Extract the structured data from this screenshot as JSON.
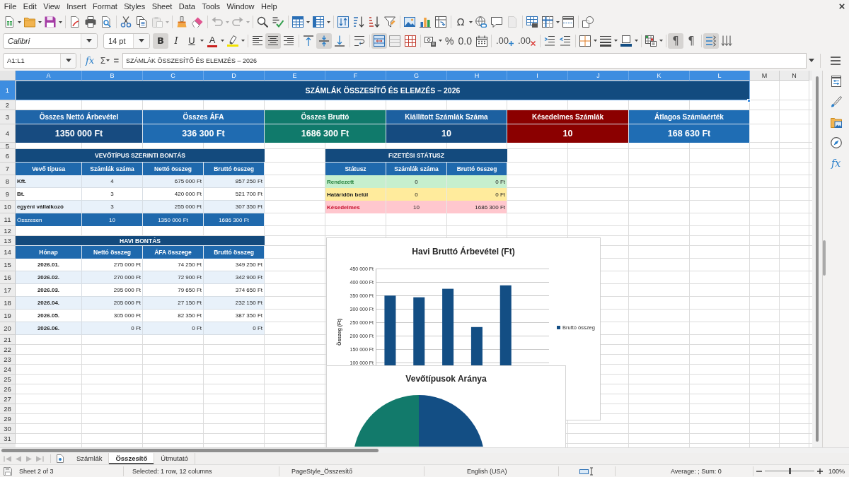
{
  "menu": [
    "File",
    "Edit",
    "View",
    "Insert",
    "Format",
    "Styles",
    "Sheet",
    "Data",
    "Tools",
    "Window",
    "Help"
  ],
  "standard_toolbar": {
    "paste": {
      "disabled": true
    },
    "undo": {
      "disabled": true
    },
    "redo": {
      "disabled": true
    },
    "special_character": "Ω",
    "headers_footers": {
      "disabled": true
    }
  },
  "format_toolbar": {
    "font_name": "Calibri",
    "font_size": "14 pt",
    "text_style": [
      {
        "label": "B",
        "selected": true
      },
      {
        "label": "I",
        "selected": false
      },
      {
        "label": "U",
        "selected": false
      }
    ],
    "font_color": "A",
    "horizontal_align": [
      {
        "selected": false
      },
      {
        "selected": true
      },
      {
        "selected": false
      }
    ],
    "vertical_align": [
      {
        "selected": false
      },
      {
        "selected": true
      },
      {
        "selected": false
      }
    ],
    "wrap_text": [
      {
        "selected": false
      }
    ],
    "merge": [
      {
        "selected": true
      },
      {
        "selected": false
      },
      {
        "selected": false
      }
    ],
    "number_format": [
      "%",
      "0.0"
    ],
    "decimals": [
      ".00",
      ".00"
    ],
    "paragraph_direction": [
      {
        "label": "¶",
        "selected": true
      },
      {
        "label": "¶",
        "selected": false
      }
    ],
    "text_direction": [
      {
        "selected": true
      },
      {
        "selected": false
      }
    ]
  },
  "formula_bar": {
    "name_box": "A1:L1",
    "function_wizard": "fx",
    "sum": "Σ",
    "equals": "=",
    "content": "SZÁMLÁK ÖSSZESÍTŐ ÉS ELEMZÉS – 2026"
  },
  "sheet": {
    "columns": [
      {
        "label": "A",
        "selected": true
      },
      {
        "label": "B",
        "selected": true
      },
      {
        "label": "C",
        "selected": true
      },
      {
        "label": "D",
        "selected": true
      },
      {
        "label": "E",
        "selected": true
      },
      {
        "label": "F",
        "selected": true
      },
      {
        "label": "G",
        "selected": true
      },
      {
        "label": "H",
        "selected": true
      },
      {
        "label": "I",
        "selected": true
      },
      {
        "label": "J",
        "selected": true
      },
      {
        "label": "K",
        "selected": true
      },
      {
        "label": "L",
        "selected": true
      },
      {
        "label": "M",
        "selected": false
      },
      {
        "label": "N",
        "selected": false
      }
    ],
    "rows": [
      {
        "label": "1",
        "selected": true
      },
      {
        "label": "2",
        "selected": false
      },
      {
        "label": "3",
        "selected": false
      },
      {
        "label": "4",
        "selected": false
      },
      {
        "label": "5",
        "selected": false
      },
      {
        "label": "6",
        "selected": false
      },
      {
        "label": "7",
        "selected": false
      },
      {
        "label": "8",
        "selected": false
      },
      {
        "label": "9",
        "selected": false
      },
      {
        "label": "10",
        "selected": false
      },
      {
        "label": "11",
        "selected": false
      },
      {
        "label": "12",
        "selected": false
      },
      {
        "label": "13",
        "selected": false
      },
      {
        "label": "14",
        "selected": false
      },
      {
        "label": "15",
        "selected": false
      },
      {
        "label": "16",
        "selected": false
      },
      {
        "label": "17",
        "selected": false
      },
      {
        "label": "18",
        "selected": false
      },
      {
        "label": "19",
        "selected": false
      },
      {
        "label": "20",
        "selected": false
      },
      {
        "label": "21",
        "selected": false
      },
      {
        "label": "22",
        "selected": false
      },
      {
        "label": "23",
        "selected": false
      },
      {
        "label": "24",
        "selected": false
      },
      {
        "label": "25",
        "selected": false
      },
      {
        "label": "26",
        "selected": false
      },
      {
        "label": "27",
        "selected": false
      },
      {
        "label": "28",
        "selected": false
      },
      {
        "label": "29",
        "selected": false
      },
      {
        "label": "30",
        "selected": false
      },
      {
        "label": "31",
        "selected": false
      }
    ],
    "title": "SZÁMLÁK ÖSSZESÍTŐ ÉS ELEMZÉS – 2026",
    "kpis": [
      {
        "label": {
          "text": "Összes Nettó Árbevétel",
          "color": "#1f65a8"
        },
        "value": {
          "text": "1350 000 Ft",
          "color": "#174b80"
        }
      },
      {
        "label": {
          "text": "Összes ÁFA",
          "color": "#1f6bb1"
        },
        "value": {
          "text": "336 300 Ft",
          "color": "#1f6bb1"
        }
      },
      {
        "label": {
          "text": "Összes Bruttó",
          "color": "#107a6b"
        },
        "value": {
          "text": "1686 300 Ft",
          "color": "#107a6b"
        }
      },
      {
        "label": {
          "text": "Kiállított Számlák Száma",
          "color": "#1c60a0"
        },
        "value": {
          "text": "10",
          "color": "#154b80"
        }
      },
      {
        "label": {
          "text": "Késedelmes Számlák",
          "color": "#8b0000"
        },
        "value": {
          "text": "10",
          "color": "#8b0000"
        }
      },
      {
        "label": {
          "text": "Átlagos Számlaérték",
          "color": "#1f6db4"
        },
        "value": {
          "text": "168 630 Ft",
          "color": "#1f6db4"
        }
      }
    ],
    "customer_breakdown": {
      "title": "VEVŐTÍPUS SZERINTI BONTÁS",
      "columns": [
        "Vevő típusa",
        "Számlák száma",
        "Nettó összeg",
        "Bruttó összeg"
      ],
      "rows": [
        {
          "cells": [
            "Kft.",
            "4",
            "675 000 Ft",
            "857 250 Ft"
          ]
        },
        {
          "cells": [
            "Bt.",
            "3",
            "420 000 Ft",
            "521 700 Ft"
          ]
        },
        {
          "cells": [
            "egyéni vállalkozó",
            "3",
            "255 000 Ft",
            "307 350 Ft"
          ]
        }
      ],
      "total": {
        "cells": [
          "Összesen",
          "10",
          "1350 000 Ft",
          "1686 300 Ft"
        ]
      }
    },
    "payment_status": {
      "title": "FIZETÉSI STÁTUSZ",
      "columns": [
        "Státusz",
        "Számlák száma",
        "Bruttó összeg"
      ],
      "rows": [
        {
          "color": "#c6efce",
          "status": {
            "text": "Rendezett",
            "color": "#23803a"
          },
          "count": "0",
          "amount": "0 Ft"
        },
        {
          "color": "#ffeb9c",
          "status": {
            "text": "Határidőn belül"
          },
          "count": "0",
          "amount": "0 Ft"
        },
        {
          "color": "#ffc7ce",
          "status": {
            "text": "Késedelmes",
            "color": "#c8102e"
          },
          "count": "10",
          "amount": "1686 300 Ft"
        }
      ]
    },
    "monthly_breakdown": {
      "title": "HAVI BONTÁS",
      "columns": [
        "Hónap",
        "Nettó összeg",
        "ÁFA összege",
        "Bruttó összeg"
      ],
      "rows": [
        {
          "cells": [
            "2026.01.",
            "275 000 Ft",
            "74 250 Ft",
            "349 250 Ft"
          ]
        },
        {
          "cells": [
            "2026.02.",
            "270 000 Ft",
            "72 900 Ft",
            "342 900 Ft"
          ]
        },
        {
          "cells": [
            "2026.03.",
            "295 000 Ft",
            "79 650 Ft",
            "374 650 Ft"
          ]
        },
        {
          "cells": [
            "2026.04.",
            "205 000 Ft",
            "27 150 Ft",
            "232 150 Ft"
          ]
        },
        {
          "cells": [
            "2026.05.",
            "305 000 Ft",
            "82 350 Ft",
            "387 350 Ft"
          ]
        },
        {
          "cells": [
            "2026.06.",
            "0 Ft",
            "0 Ft",
            "0 Ft"
          ]
        }
      ]
    },
    "monthly_chart": {
      "chart_data": {
        "type": "bar",
        "title": "Havi Bruttó Árbevétel (Ft)",
        "ylabel": "Összeg (Ft)",
        "series": [
          {
            "name": "Bruttó összeg",
            "color": "#134e84",
            "values": [
              349250,
              342900,
              374650,
              232150,
              387350,
              0
            ]
          }
        ],
        "ylim": [
          0,
          450000
        ],
        "yticks": [
          {
            "value": 100000,
            "label": "100 000 Ft"
          },
          {
            "value": 150000,
            "label": "150 000 Ft"
          },
          {
            "value": 200000,
            "label": "200 000 Ft"
          },
          {
            "value": 250000,
            "label": "250 000 Ft"
          },
          {
            "value": 300000,
            "label": "300 000 Ft"
          },
          {
            "value": 350000,
            "label": "350 000 Ft"
          },
          {
            "value": 400000,
            "label": "400 000 Ft"
          },
          {
            "value": 450000,
            "label": "450 000 Ft"
          }
        ],
        "grid": true
      }
    },
    "customer_chart": {
      "title": "Vevőtípusok Aránya"
    }
  },
  "sidebar": {
    "functions": "fx"
  },
  "sheet_navigation": [
    {
      "disabled": true
    },
    {
      "disabled": true
    },
    {
      "disabled": true
    },
    {
      "disabled": true
    }
  ],
  "sheet_tabs": [
    {
      "label": "Számlák",
      "selected": false
    },
    {
      "label": "Összesítő",
      "selected": true
    },
    {
      "label": "Útmutató",
      "selected": false
    }
  ],
  "status_bar": {
    "sheet": "Sheet 2 of 3",
    "selection": "Selected: 1 row, 12 columns",
    "page_style": "PageStyle_Összesítő",
    "language": "English (USA)",
    "summary": "Average: ; Sum: 0",
    "zoom_slider": {
      "level": 0.5
    },
    "zoom": "100%"
  }
}
